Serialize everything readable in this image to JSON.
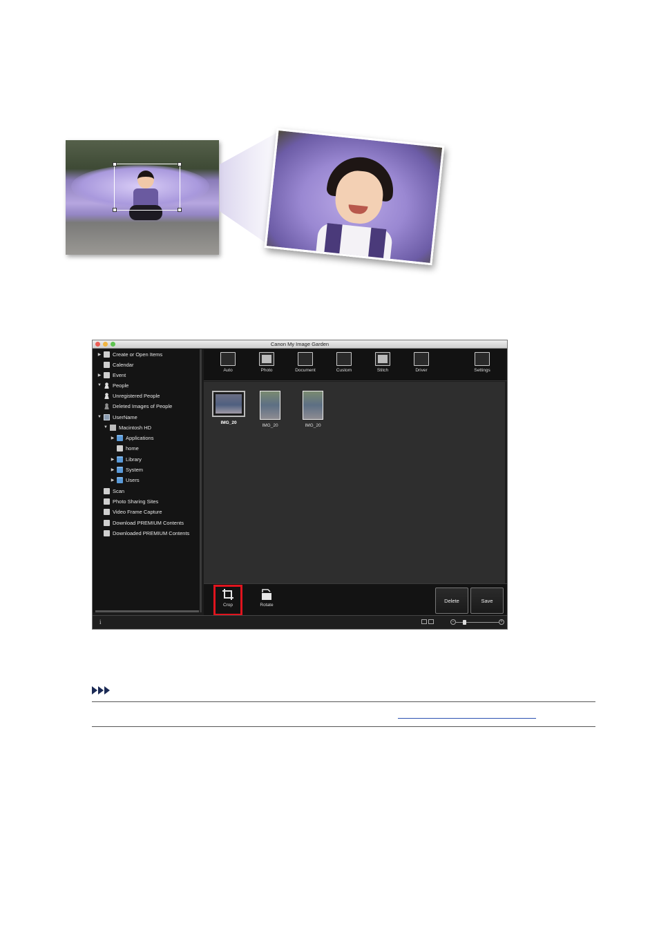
{
  "window": {
    "title": "Canon My Image Garden",
    "traffic_lights": [
      "#ee5d54",
      "#f2b640",
      "#5fc451"
    ]
  },
  "sidebar": {
    "items": [
      {
        "label": "Create or Open Items",
        "icon": "create-icon",
        "arrow": "▶"
      },
      {
        "label": "Calendar",
        "icon": "calendar-icon",
        "arrow": ""
      },
      {
        "label": "Event",
        "icon": "event-icon",
        "arrow": "▶"
      },
      {
        "label": "People",
        "icon": "person-icon",
        "arrow": "▼"
      },
      {
        "label": "Unregistered People",
        "icon": "person-icon",
        "arrow": ""
      },
      {
        "label": "Deleted Images of People",
        "icon": "deleted-person-icon",
        "arrow": ""
      },
      {
        "label": "UserName",
        "icon": "computer-icon",
        "arrow": "▼"
      },
      {
        "label": "Macintosh HD",
        "icon": "hard-drive-icon",
        "arrow": "▼"
      },
      {
        "label": "Applications",
        "icon": "folder-icon",
        "arrow": "▶"
      },
      {
        "label": "home",
        "icon": "home-icon",
        "arrow": ""
      },
      {
        "label": "Library",
        "icon": "folder-icon",
        "arrow": "▶"
      },
      {
        "label": "System",
        "icon": "folder-icon",
        "arrow": "▶"
      },
      {
        "label": "Users",
        "icon": "folder-icon",
        "arrow": "▶"
      },
      {
        "label": "Scan",
        "icon": "scan-icon",
        "arrow": ""
      },
      {
        "label": "Photo Sharing Sites",
        "icon": "photo-sharing-icon",
        "arrow": ""
      },
      {
        "label": "Video Frame Capture",
        "icon": "video-frame-icon",
        "arrow": ""
      },
      {
        "label": "Download PREMIUM Contents",
        "icon": "download-icon",
        "arrow": ""
      },
      {
        "label": "Downloaded PREMIUM Contents",
        "icon": "downloaded-icon",
        "arrow": ""
      }
    ]
  },
  "toolbar": {
    "auto": "Auto",
    "photo": "Photo",
    "document": "Document",
    "custom": "Custom",
    "stitch": "Stitch",
    "driver": "Driver",
    "settings": "Settings"
  },
  "thumbnails": [
    {
      "caption": "IMG_20",
      "selected": true
    },
    {
      "caption": "IMG_20",
      "selected": false
    },
    {
      "caption": "IMG_20",
      "selected": false
    }
  ],
  "bottom": {
    "crop": "Crop",
    "rotate": "Rotate",
    "delete": "Delete",
    "save": "Save"
  },
  "status": {
    "info": "i",
    "zoom_level": 0.2
  },
  "colors": {
    "crop_highlight": "#e0141e",
    "link": "#2a4fb0"
  }
}
